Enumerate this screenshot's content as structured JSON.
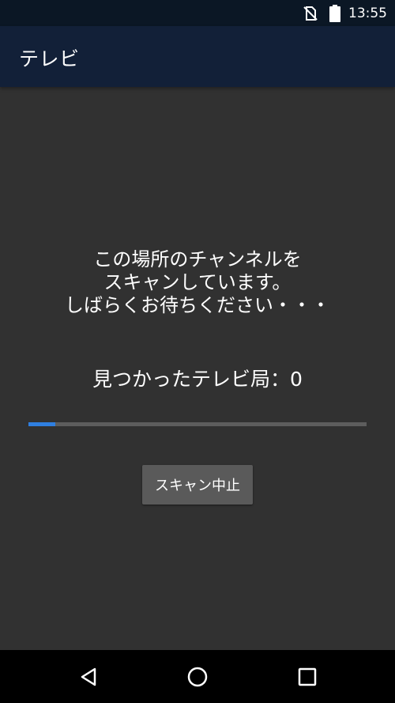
{
  "status_bar": {
    "time": "13:55",
    "icons": [
      "no-sim-icon",
      "battery-icon"
    ]
  },
  "app_bar": {
    "title": "テレビ"
  },
  "scan": {
    "message_lines": [
      "この場所のチャンネルを",
      "スキャンしています。",
      "しばらくお待ちください・・・"
    ],
    "found_label": "見つかったテレビ局：",
    "found_count": "0",
    "progress_fraction": 0.08,
    "stop_button_label": "スキャン中止"
  },
  "colors": {
    "background": "#313131",
    "status_bar": "#0b1725",
    "app_bar": "#122038",
    "progress_accent": "#2f7fe0",
    "progress_track": "#5d5d5d",
    "button": "#5a5a5a"
  },
  "nav_bar": {
    "icons": [
      "back-icon",
      "home-icon",
      "recents-icon"
    ]
  }
}
